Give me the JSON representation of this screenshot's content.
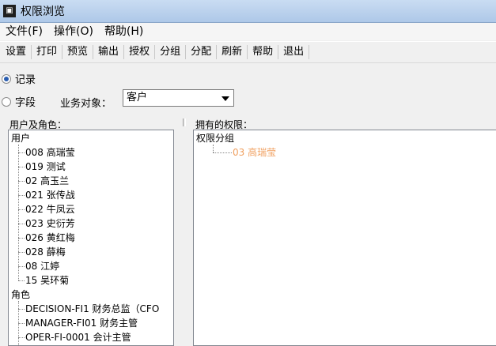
{
  "window": {
    "title": "权限浏览"
  },
  "menubar": {
    "items": [
      "文件(F)",
      "操作(O)",
      "帮助(H)"
    ]
  },
  "toolbar": {
    "buttons": [
      "设置",
      "打印",
      "预览",
      "输出",
      "授权",
      "分组",
      "分配",
      "刷新",
      "帮助",
      "退出"
    ]
  },
  "options": {
    "record_label": "记录",
    "field_label": "字段",
    "selected": "记录",
    "business_object_label": "业务对象：",
    "business_object_value": "客户"
  },
  "left_panel": {
    "label": "用户及角色：",
    "users_root": "用户",
    "users": [
      "008   高瑞莹",
      "019   测试",
      "02   高玉兰",
      "021   张传战",
      "022   牛凤云",
      "023   史衍芳",
      "026   黄红梅",
      "028   薛梅",
      "08   江婷",
      "15   吴环菊"
    ],
    "roles_root": "角色",
    "roles": [
      "DECISION-FI1   财务总监（CFO",
      "MANAGER-FI01   财务主管",
      "OPER-FI-0001   会计主管"
    ]
  },
  "right_panel": {
    "label": "拥有的权限：",
    "root": "权限分组",
    "items": [
      "03   高瑞莹"
    ]
  },
  "colors": {
    "permission_item": "#f0a060",
    "radio_accent": "#2a5db0"
  }
}
